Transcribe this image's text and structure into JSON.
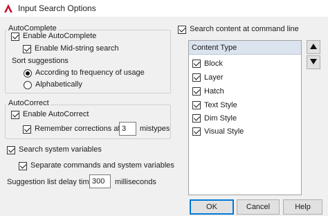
{
  "window": {
    "title": "Input Search Options",
    "accent_color": "#c8102e"
  },
  "autocomplete": {
    "group_label": "AutoComplete",
    "enable_label": "Enable AutoComplete",
    "enable_checked": true,
    "midstring_label": "Enable Mid-string search",
    "midstring_checked": true,
    "sort_label": "Sort suggestions",
    "sort_options": [
      {
        "label": "According to frequency of usage",
        "selected": true
      },
      {
        "label": "Alphabetically",
        "selected": false
      }
    ]
  },
  "autocorrect": {
    "group_label": "AutoCorrect",
    "enable_label": "Enable AutoCorrect",
    "enable_checked": true,
    "remember_label": "Remember corrections after",
    "remember_checked": true,
    "remember_value": "3",
    "remember_suffix": "mistypes"
  },
  "system_vars": {
    "search_label": "Search system variables",
    "search_checked": true,
    "separate_label": "Separate commands and system variables",
    "separate_checked": true
  },
  "delay": {
    "label": "Suggestion list delay time",
    "value": "300",
    "unit": "milliseconds"
  },
  "content": {
    "search_label": "Search content at command line",
    "search_checked": true,
    "header": "Content Type",
    "items": [
      {
        "label": "Block",
        "checked": true
      },
      {
        "label": "Layer",
        "checked": true
      },
      {
        "label": "Hatch",
        "checked": true
      },
      {
        "label": "Text Style",
        "checked": true
      },
      {
        "label": "Dim Style",
        "checked": true
      },
      {
        "label": "Visual Style",
        "checked": true
      }
    ],
    "move_up_icon": "triangle-up-icon",
    "move_down_icon": "triangle-down-icon"
  },
  "buttons": {
    "ok": "OK",
    "cancel": "Cancel",
    "help": "Help"
  }
}
